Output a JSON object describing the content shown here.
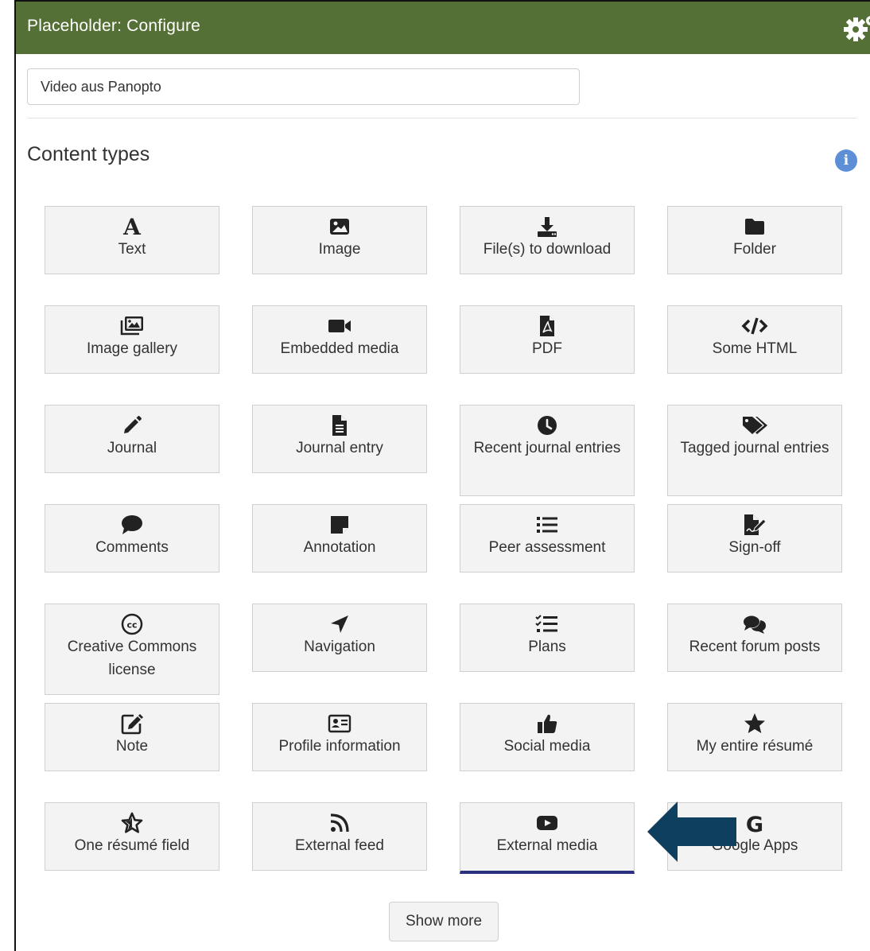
{
  "header": {
    "title": "Placeholder: Configure",
    "settings_icon": "gears-icon"
  },
  "form": {
    "title_value": "Video aus Panopto"
  },
  "content_types": {
    "heading": "Content types",
    "info_icon": "info-icon",
    "tiles": [
      {
        "label": "Text",
        "icon": "text-icon"
      },
      {
        "label": "Image",
        "icon": "image-icon"
      },
      {
        "label": "File(s) to download",
        "icon": "download-icon"
      },
      {
        "label": "Folder",
        "icon": "folder-icon"
      },
      {
        "label": "Image gallery",
        "icon": "images-icon"
      },
      {
        "label": "Embedded media",
        "icon": "video-camera-icon"
      },
      {
        "label": "PDF",
        "icon": "file-pdf-icon"
      },
      {
        "label": "Some HTML",
        "icon": "code-icon"
      },
      {
        "label": "Journal",
        "icon": "pencil-icon"
      },
      {
        "label": "Journal entry",
        "icon": "file-text-icon"
      },
      {
        "label": "Recent journal entries",
        "icon": "clock-icon"
      },
      {
        "label": "Tagged journal entries",
        "icon": "tags-icon"
      },
      {
        "label": "Comments",
        "icon": "comment-icon"
      },
      {
        "label": "Annotation",
        "icon": "sticky-note-icon"
      },
      {
        "label": "Peer assessment",
        "icon": "list-icon"
      },
      {
        "label": "Sign-off",
        "icon": "file-signature-icon"
      },
      {
        "label": "Creative Commons license",
        "icon": "creative-commons-icon"
      },
      {
        "label": "Navigation",
        "icon": "location-arrow-icon"
      },
      {
        "label": "Plans",
        "icon": "tasks-icon"
      },
      {
        "label": "Recent forum posts",
        "icon": "comments-icon"
      },
      {
        "label": "Note",
        "icon": "edit-icon"
      },
      {
        "label": "Profile information",
        "icon": "id-card-icon"
      },
      {
        "label": "Social media",
        "icon": "thumbs-up-icon"
      },
      {
        "label": "My entire résumé",
        "icon": "star-icon"
      },
      {
        "label": "One résumé field",
        "icon": "star-outline-icon"
      },
      {
        "label": "External feed",
        "icon": "rss-icon"
      },
      {
        "label": "External media",
        "icon": "youtube-icon",
        "selected": true
      },
      {
        "label": "Google Apps",
        "icon": "google-icon"
      }
    ]
  },
  "show_more_label": "Show more",
  "colors": {
    "header_bg": "#557036",
    "tile_bg": "#f3f3f3",
    "selected_underline": "#29307e",
    "arrow": "#0e3f5e",
    "info": "#5d8fd6"
  },
  "annotation": {
    "icon": "pointer-arrow-icon"
  }
}
